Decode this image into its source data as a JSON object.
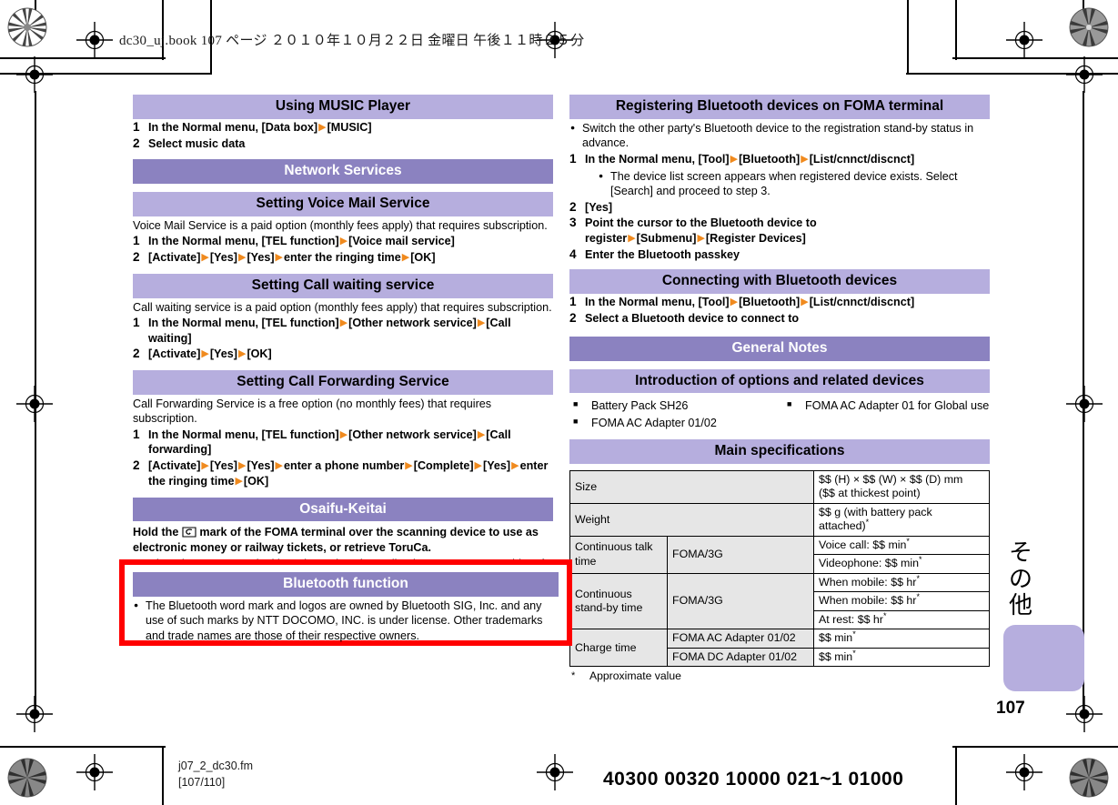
{
  "page_slug": "dc30_uj.book  107 ページ  ２０１０年１０月２２日  金曜日  午後１１時２５分",
  "colors": {
    "section_bar": "#b6aede",
    "chapter_bar": "#8b82c0",
    "arrow": "#F08A1E",
    "annotation": "#ff0000",
    "table_key_bg": "#e6e6e6"
  },
  "left_column": {
    "music_header": "Using MUSIC Player",
    "music_steps": [
      {
        "num": "1",
        "parts": [
          "In the Normal menu, [Data box]",
          "[MUSIC]"
        ]
      },
      {
        "num": "2",
        "parts": [
          "Select music data"
        ]
      }
    ],
    "network_chapter": "Network Services",
    "voicemail_header": "Setting Voice Mail Service",
    "voicemail_intro": "Voice Mail Service is a paid option (monthly fees apply) that requires subscription.",
    "voicemail_steps": [
      {
        "num": "1",
        "parts": [
          "In the Normal menu, [TEL function]",
          "[Voice mail service]"
        ]
      },
      {
        "num": "2",
        "parts": [
          "[Activate]",
          "[Yes]",
          "[Yes]",
          "enter the ringing time",
          "[OK]"
        ]
      }
    ],
    "callwaiting_header": "Setting Call waiting service",
    "callwaiting_intro": "Call waiting service is a paid option (monthly fees apply) that requires subscription.",
    "callwaiting_steps": [
      {
        "num": "1",
        "parts": [
          "In the Normal menu, [TEL function]",
          "[Other network service]",
          "[Call waiting]"
        ]
      },
      {
        "num": "2",
        "parts": [
          "[Activate]",
          "[Yes]",
          "[OK]"
        ]
      }
    ],
    "callfwd_header": "Setting Call Forwarding Service",
    "callfwd_intro": "Call Forwarding Service is a free option (no monthly fees) that requires subscription.",
    "callfwd_steps": [
      {
        "num": "1",
        "parts": [
          "In the Normal menu, [TEL function]",
          "[Other network service]",
          "[Call forwarding]"
        ]
      },
      {
        "num": "2",
        "parts": [
          "[Activate]",
          "[Yes]",
          "[Yes]",
          "enter a phone number",
          "[Complete]",
          "[Yes]",
          "enter the ringing time",
          "[OK]"
        ]
      }
    ],
    "osaifu_chapter": "Osaifu-Keitai",
    "osaifu_lead_before": "Hold the",
    "osaifu_icon": "felica-mark-icon",
    "osaifu_lead_after": "mark of the FOMA terminal over the scanning device to use as electronic money or railway tickets, or retrieve ToruCa.",
    "osaifu_bullet": "When the FOMA terminal is stolen or lost, immediately contact your provider of Osaifu-Keitai compatible service for handling methods."
  },
  "annotation_box": {
    "bluetooth_chapter": "Bluetooth function",
    "bluetooth_bullet": "The Bluetooth word mark and logos are owned by Bluetooth SIG, Inc. and any use of such marks by NTT DOCOMO, INC. is under license. Other trademarks and trade names are those of their respective owners."
  },
  "right_column": {
    "register_header": "Registering Bluetooth devices on FOMA terminal",
    "register_bullet": "Switch the other party's Bluetooth device to the registration stand-by status in advance.",
    "register_steps": [
      {
        "num": "1",
        "parts": [
          "In the Normal menu, [Tool]",
          "[Bluetooth]",
          "[List/cnnct/discnct]"
        ],
        "subbullet": "The device list screen appears when registered device exists. Select [Search] and proceed to step 3."
      },
      {
        "num": "2",
        "parts": [
          "[Yes]"
        ]
      },
      {
        "num": "3",
        "parts": [
          "Point the cursor to the Bluetooth device to register",
          "[Submenu]",
          "[Register Devices]"
        ]
      },
      {
        "num": "4",
        "parts": [
          "Enter the Bluetooth passkey"
        ]
      }
    ],
    "connecting_header": "Connecting with Bluetooth devices",
    "connecting_steps": [
      {
        "num": "1",
        "parts": [
          "In the Normal menu, [Tool]",
          "[Bluetooth]",
          "[List/cnnct/discnct]"
        ]
      },
      {
        "num": "2",
        "parts": [
          "Select a Bluetooth device to connect to"
        ]
      }
    ],
    "general_chapter": "General Notes",
    "options_header": "Introduction of options and related devices",
    "options": [
      "Battery Pack SH26",
      "FOMA AC Adapter 01 for Global use",
      "FOMA AC Adapter 01/02"
    ],
    "spec_header": "Main specifications",
    "spec_footnote_symbol": "*",
    "spec_footnote": "Approximate value"
  },
  "spec_table": {
    "type": "table",
    "rows": [
      {
        "key": "Size",
        "key_rowspan": 1,
        "mid": null,
        "values": [
          "$$ (H) × $$ (W) × $$ (D) mm",
          "($$ at thickest point)"
        ],
        "single_cell_multiline": true
      },
      {
        "key": "Weight",
        "mid": null,
        "value": "$$ g (with battery pack attached)",
        "sup": "*"
      },
      {
        "key": "Continuous talk time",
        "mid": "FOMA/3G",
        "value": "Voice call: $$ min",
        "sup": "*"
      },
      {
        "key": "",
        "mid": "",
        "value": "Videophone: $$ min",
        "sup": "*"
      },
      {
        "key": "Continuous stand-by time",
        "mid": "FOMA/3G",
        "value": "When mobile: $$ hr",
        "sup": "*"
      },
      {
        "key": "",
        "mid": "",
        "value": "When mobile: $$ hr",
        "sup": "*"
      },
      {
        "key": "",
        "mid": "",
        "value": "At rest: $$ hr",
        "sup": "*"
      },
      {
        "key": "Charge time",
        "mid": "FOMA AC Adapter 01/02",
        "value": "$$ min",
        "sup": "*"
      },
      {
        "key": "",
        "mid": "FOMA DC Adapter 01/02",
        "value": "$$ min",
        "sup": "*"
      }
    ]
  },
  "side_tab": {
    "label_chars": [
      "そ",
      "の",
      "他"
    ],
    "page_number": "107"
  },
  "footer": {
    "fm_name": "j07_2_dc30.fm",
    "fm_pages": "[107/110]",
    "barcode_number": "40300 00320 10000 021~1 01000"
  }
}
